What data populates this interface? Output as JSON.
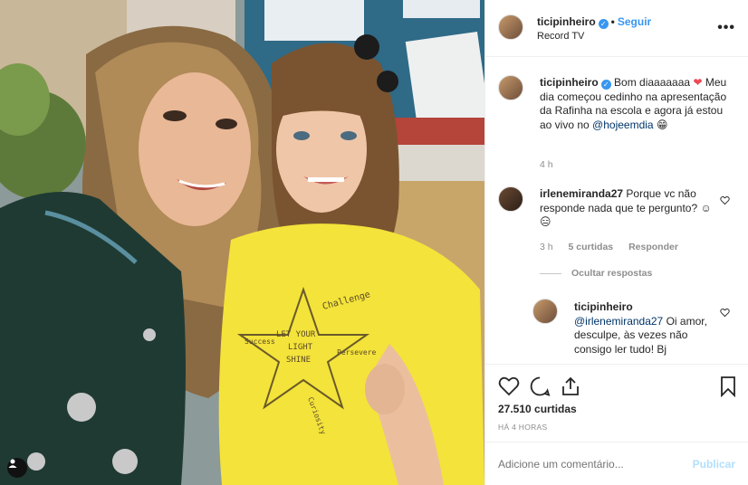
{
  "post": {
    "username": "ticipinheiro",
    "verified_badge": "✓",
    "separator": "•",
    "follow_label": "Seguir",
    "location": "Record TV",
    "more_icon": "more-horizontal-icon"
  },
  "caption": {
    "username": "ticipinheiro",
    "text_1": "Bom diaaaaaaa",
    "heart": "❤",
    "text_2": "Meu dia começou cedinho na apresentação da Rafinha na escola e agora já estou ao vivo no",
    "mention": "@hojeemdia",
    "emoji": "😁",
    "time": "4 h"
  },
  "comments": [
    {
      "username": "irlenemiranda27",
      "text": "Porque vc não responde nada que te pergunto? ☺😑",
      "time": "3 h",
      "likes": "5 curtidas",
      "reply_label": "Responder"
    }
  ],
  "hide_replies_label": "Ocultar respostas",
  "reply": {
    "username": "ticipinheiro",
    "mention": "@irlenemiranda27",
    "text": "Oi amor, desculpe, às vezes não consigo ler tudo! Bj"
  },
  "actions": {
    "likes_count": "27.510 curtidas",
    "date": "HÁ 4 HORAS"
  },
  "add_comment": {
    "placeholder": "Adicione um comentário...",
    "publish_label": "Publicar"
  },
  "photo": {
    "shirt_text_1": "LET YOUR",
    "shirt_text_2": "LIGHT",
    "shirt_text_3": "SHINE",
    "shirt_text_4": "Challenge",
    "shirt_text_5": "Persevere",
    "shirt_text_6": "Curiosity",
    "shirt_text_7": "Success"
  },
  "colors": {
    "link_blue": "#3897f0",
    "mention_blue": "#003569",
    "muted": "#8e8e8e",
    "heart_red": "#ed4956",
    "shirt_yellow": "#f4e33a"
  }
}
